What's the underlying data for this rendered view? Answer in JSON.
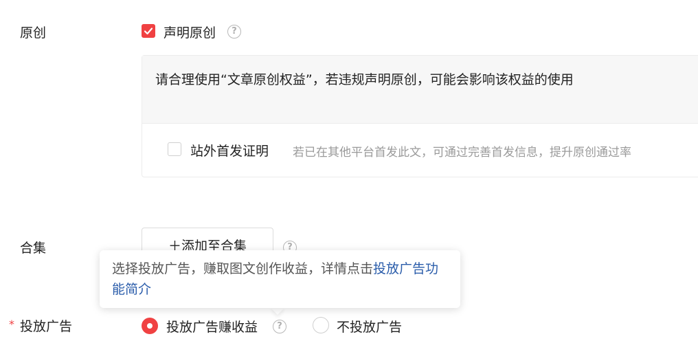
{
  "original": {
    "label": "原创",
    "declare_label": "声明原创",
    "declare_checked": true,
    "notice": "请合理使用“文章原创权益”，若违规声明原创，可能会影响该权益的使用",
    "offsite": {
      "label": "站外首发证明",
      "hint": "若已在其他平台首发此文，可通过完善首发信息，提升原创通过率",
      "checked": false
    }
  },
  "collection": {
    "label": "合集",
    "add_button": "＋添加至合集"
  },
  "tooltip": {
    "text": "选择投放广告，赚取图文创作收益，详情点击",
    "link": "投放广告功能简介"
  },
  "ads": {
    "required_mark": "*",
    "label": "投放广告",
    "option_on": "投放广告赚收益",
    "option_off": "不投放广告",
    "selected": "option_on"
  },
  "help_glyph": "?",
  "colors": {
    "accent": "#f04142",
    "link": "#2a5caa",
    "hint": "#9a9a9a"
  }
}
